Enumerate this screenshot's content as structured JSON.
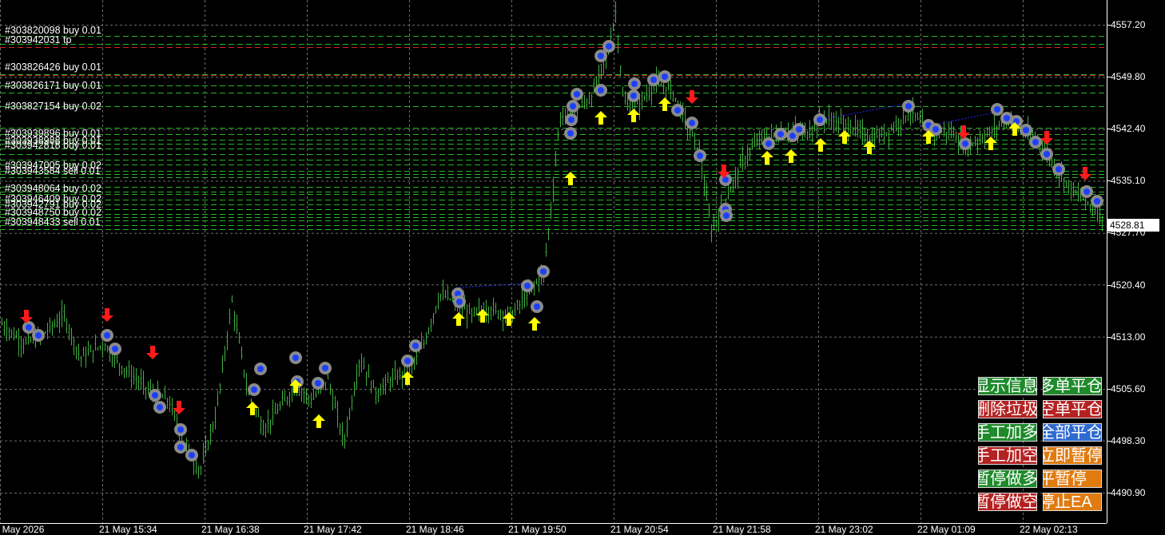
{
  "price_axis": {
    "labels": [
      "4557.20",
      "4549.80",
      "4542.40",
      "4535.10",
      "4527.70",
      "4520.40",
      "4513.00",
      "4505.60",
      "4498.30",
      "4490.90"
    ],
    "current_price": "4528.81"
  },
  "time_axis": {
    "labels": [
      "21 May 2026",
      "21 May 15:34",
      "21 May 16:38",
      "21 May 17:42",
      "21 May 18:46",
      "21 May 19:50",
      "21 May 20:54",
      "21 May 21:58",
      "21 May 23:02",
      "22 May 01:09",
      "22 May 02:13"
    ]
  },
  "order_labels": [
    "#303820098 buy 0.01",
    "#303942031 tp",
    "#303826426 buy 0.01",
    "#303826171 buy 0.01",
    "#303827154 buy 0.02",
    "#303939896 buy 0.01",
    "#303938988 buy 0.01",
    "#303942818 buy 0.01",
    "#303947005 buy 0.02",
    "#303943584 sell 0.01",
    "#303948064 buy 0.02",
    "#303946409 buy 0.02",
    "#303942791 buy 0.02",
    "#303948750 buy 0.02",
    "#303948433 sell 0.01"
  ],
  "panel_buttons": [
    {
      "label": "显示信息",
      "color": "#1f8a2c"
    },
    {
      "label": "多单平仓",
      "color": "#1f8a2c"
    },
    {
      "label": "删除垃圾",
      "color": "#b52222"
    },
    {
      "label": "空单平仓",
      "color": "#b52222"
    },
    {
      "label": "手工加多",
      "color": "#1f8a2c"
    },
    {
      "label": "全部平仓",
      "color": "#2f6ad0"
    },
    {
      "label": "手工加空",
      "color": "#b52222"
    },
    {
      "label": "立即暂停",
      "color": "#e07b10"
    },
    {
      "label": "暂停做多",
      "color": "#1f8a2c"
    },
    {
      "label": "平暂停",
      "color": "#e07b10"
    },
    {
      "label": "暂停做空",
      "color": "#b52222"
    },
    {
      "label": "停止EA",
      "color": "#e07b10"
    }
  ],
  "colors": {
    "candle": "#3fae3f",
    "grid": "#6b6b6b",
    "buy_line": "#26b526",
    "sell_line": "#d62020",
    "arrow_up": "#ffff00",
    "arrow_down": "#ff1a1a"
  },
  "chart_data": {
    "type": "candlestick",
    "y_range": [
      4487.5,
      4561.5
    ],
    "x_labels": [
      "21 May 2026",
      "21 May 15:34",
      "21 May 16:38",
      "21 May 17:42",
      "21 May 18:46",
      "21 May 19:50",
      "21 May 20:54",
      "21 May 21:58",
      "21 May 23:02",
      "22 May 01:09",
      "22 May 02:13"
    ],
    "last_price": 4528.81,
    "close_path": [
      [
        0,
        4515
      ],
      [
        30,
        4512
      ],
      [
        50,
        4513
      ],
      [
        80,
        4516
      ],
      [
        100,
        4510
      ],
      [
        130,
        4512
      ],
      [
        150,
        4509
      ],
      [
        170,
        4507
      ],
      [
        190,
        4505
      ],
      [
        210,
        4504
      ],
      [
        230,
        4498
      ],
      [
        250,
        4494
      ],
      [
        270,
        4502
      ],
      [
        290,
        4518
      ],
      [
        310,
        4505
      ],
      [
        330,
        4500
      ],
      [
        350,
        4503
      ],
      [
        370,
        4506
      ],
      [
        390,
        4504
      ],
      [
        410,
        4507
      ],
      [
        430,
        4498
      ],
      [
        450,
        4510
      ],
      [
        470,
        4505
      ],
      [
        490,
        4507
      ],
      [
        510,
        4508
      ],
      [
        530,
        4512
      ],
      [
        550,
        4519
      ],
      [
        570,
        4518
      ],
      [
        590,
        4516
      ],
      [
        610,
        4517
      ],
      [
        640,
        4516
      ],
      [
        660,
        4519
      ],
      [
        680,
        4522
      ],
      [
        690,
        4532
      ],
      [
        700,
        4544
      ],
      [
        720,
        4545
      ],
      [
        740,
        4547
      ],
      [
        760,
        4553
      ],
      [
        770,
        4559
      ],
      [
        780,
        4546
      ],
      [
        800,
        4546
      ],
      [
        820,
        4549
      ],
      [
        840,
        4548
      ],
      [
        860,
        4543
      ],
      [
        875,
        4539
      ],
      [
        890,
        4528
      ],
      [
        910,
        4533
      ],
      [
        930,
        4538
      ],
      [
        950,
        4541
      ],
      [
        980,
        4542
      ],
      [
        1010,
        4542
      ],
      [
        1030,
        4544
      ],
      [
        1060,
        4543
      ],
      [
        1090,
        4541
      ],
      [
        1110,
        4542
      ],
      [
        1140,
        4545
      ],
      [
        1160,
        4542
      ],
      [
        1190,
        4542
      ],
      [
        1210,
        4540
      ],
      [
        1240,
        4542
      ],
      [
        1260,
        4544
      ],
      [
        1280,
        4542
      ],
      [
        1300,
        4541
      ],
      [
        1320,
        4537
      ],
      [
        1340,
        4534
      ],
      [
        1360,
        4532
      ],
      [
        1380,
        4530
      ]
    ]
  }
}
